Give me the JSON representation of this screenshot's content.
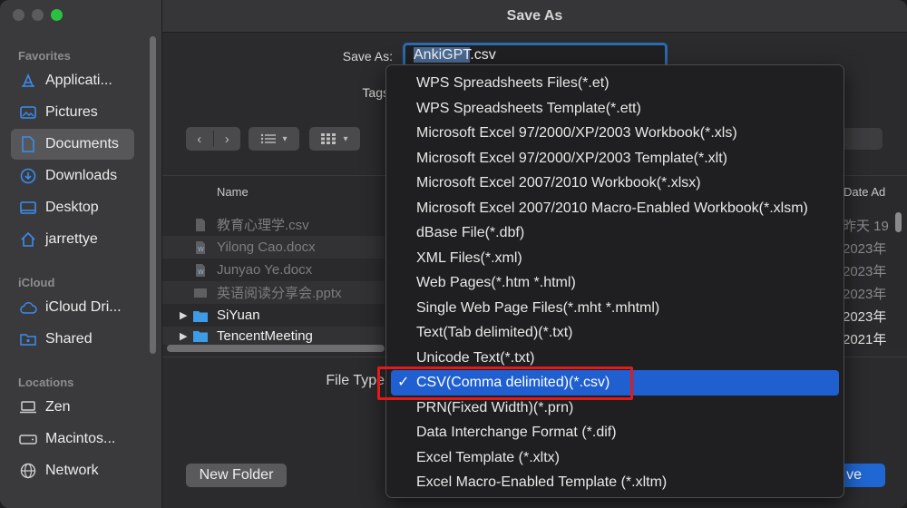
{
  "window": {
    "title": "Save As"
  },
  "sidebar": {
    "sections": [
      {
        "label": "Favorites",
        "items": [
          {
            "label": "Applicati...",
            "icon": "applications-icon"
          },
          {
            "label": "Pictures",
            "icon": "pictures-icon"
          },
          {
            "label": "Documents",
            "icon": "documents-icon",
            "active": true
          },
          {
            "label": "Downloads",
            "icon": "downloads-icon"
          },
          {
            "label": "Desktop",
            "icon": "desktop-icon"
          },
          {
            "label": "jarrettye",
            "icon": "home-icon"
          }
        ]
      },
      {
        "label": "iCloud",
        "items": [
          {
            "label": "iCloud Dri...",
            "icon": "icloud-icon"
          },
          {
            "label": "Shared",
            "icon": "shared-folder-icon"
          }
        ]
      },
      {
        "label": "Locations",
        "items": [
          {
            "label": "Zen",
            "icon": "laptop-icon"
          },
          {
            "label": "Macintos...",
            "icon": "disk-icon"
          },
          {
            "label": "Network",
            "icon": "network-icon"
          }
        ]
      }
    ]
  },
  "form": {
    "save_as_label": "Save As:",
    "filename_selected": "AnkiGPT",
    "filename_ext": ".csv",
    "tags_label": "Tags",
    "file_type_label": "File Type"
  },
  "columns": {
    "name": "Name",
    "date": "Date Ad"
  },
  "files": [
    {
      "name": "教育心理学.csv",
      "date": "昨天 19",
      "kind": "csv",
      "dim": true
    },
    {
      "name": "Yilong Cao.docx",
      "date": "2023年",
      "kind": "docx",
      "dim": true
    },
    {
      "name": "Junyao Ye.docx",
      "date": "2023年",
      "kind": "docx",
      "dim": true
    },
    {
      "name": "英语阅读分享会.pptx",
      "date": "2023年",
      "kind": "pptx",
      "dim": true
    },
    {
      "name": "SiYuan",
      "date": "2023年",
      "kind": "folder",
      "dim": false
    },
    {
      "name": "TencentMeeting",
      "date": "2021年",
      "kind": "folder",
      "dim": false
    }
  ],
  "file_types": [
    "WPS Spreadsheets Files(*.et)",
    "WPS Spreadsheets Template(*.ett)",
    "Microsoft Excel 97/2000/XP/2003 Workbook(*.xls)",
    "Microsoft Excel 97/2000/XP/2003 Template(*.xlt)",
    "Microsoft Excel 2007/2010 Workbook(*.xlsx)",
    "Microsoft Excel 2007/2010 Macro-Enabled Workbook(*.xlsm)",
    "dBase File(*.dbf)",
    "XML Files(*.xml)",
    "Web Pages(*.htm *.html)",
    "Single Web Page Files(*.mht *.mhtml)",
    "Text(Tab delimited)(*.txt)",
    "Unicode Text(*.txt)",
    "CSV(Comma delimited)(*.csv)",
    "PRN(Fixed Width)(*.prn)",
    "Data Interchange Format (*.dif)",
    "Excel Template (*.xltx)",
    "Excel Macro-Enabled Template (*.xltm)"
  ],
  "selected_file_type_index": 12,
  "check_mark": "✓",
  "buttons": {
    "new_folder": "New Folder",
    "save": "ve"
  },
  "colors": {
    "accent": "#1f5fd0",
    "highlight_box": "#e21a1a"
  }
}
